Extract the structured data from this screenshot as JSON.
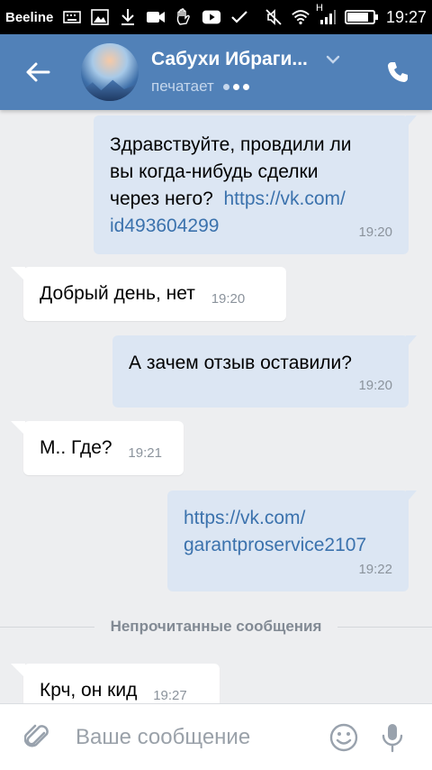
{
  "status_bar": {
    "carrier": "Beeline",
    "network_type": "H",
    "time": "19:27",
    "battery_level_percent": 85,
    "icons_left": [
      "keyboard-icon",
      "image-icon",
      "download-icon",
      "video-camera-icon",
      "hand-icon",
      "youtube-icon",
      "check-icon"
    ],
    "icons_right": [
      "muted-icon",
      "wifi-icon",
      "signal-icon",
      "battery-icon"
    ]
  },
  "header": {
    "contact_name": "Сабухи Ибраги...",
    "status": "печатает",
    "back_icon": "arrow-left-icon",
    "call_icon": "phone-icon",
    "colors": {
      "background": "#5181b8",
      "status": "#c4d6ec"
    }
  },
  "messages": [
    {
      "direction": "out",
      "text": "Здравствуйте, провдили ли вы когда-нибудь сделки через него?",
      "link": "https://vk.com/id493604299",
      "time": "19:20"
    },
    {
      "direction": "in",
      "text": "Добрый день, нет",
      "time": "19:20"
    },
    {
      "direction": "out",
      "text": "А зачем отзыв оставили?",
      "time": "19:20"
    },
    {
      "direction": "in",
      "text": "М.. Где?",
      "time": "19:21"
    },
    {
      "direction": "out",
      "link": "https://vk.com/garantproservice2107",
      "time": "19:22"
    },
    {
      "direction": "in",
      "text": "Крч, он кид",
      "time": "19:27"
    }
  ],
  "message_lines": {
    "m1_line1": "Здравствуйте, провдили ли",
    "m1_line2": "вы когда-нибудь сделки",
    "m1_line3": "через него?",
    "m1_link_part1": "https://vk.com/",
    "m1_link_part2": "id493604299",
    "m5_link_part1": "https://vk.com/",
    "m5_link_part2": "garantproservice2107"
  },
  "unread_divider": "Непрочитанные сообщения",
  "composer": {
    "placeholder": "Ваше сообщение",
    "attach_icon": "paperclip-icon",
    "emoji_icon": "smile-icon",
    "mic_icon": "microphone-icon"
  },
  "colors": {
    "chat_background": "#edeef0",
    "outgoing_bubble": "#dce6f3",
    "incoming_bubble": "#ffffff",
    "link": "#3b72ad",
    "timestamp": "#8b939c"
  }
}
